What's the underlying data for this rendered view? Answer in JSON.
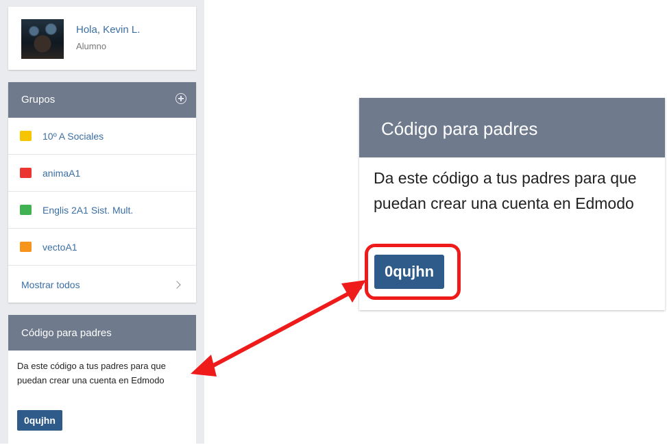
{
  "profile": {
    "greeting": "Hola, Kevin L.",
    "role": "Alumno"
  },
  "groups": {
    "title": "Grupos",
    "items": [
      {
        "label": "10º A Sociales",
        "color": "#f6c400"
      },
      {
        "label": "animaA1",
        "color": "#ea3531"
      },
      {
        "label": "Englis 2A1 Sist. Mult.",
        "color": "#41b252"
      },
      {
        "label": "vectoA1",
        "color": "#f6941c"
      }
    ],
    "show_all": "Mostrar todos"
  },
  "parent_code": {
    "title": "Código para padres",
    "description": "Da este código a tus padres para que puedan crear una cuenta en Edmodo",
    "code": "0qujhn"
  },
  "colors": {
    "accent": "#2e5b8a",
    "header": "#6f7a8d",
    "link": "#3a6ea5",
    "annotation": "#ef1b1b"
  }
}
